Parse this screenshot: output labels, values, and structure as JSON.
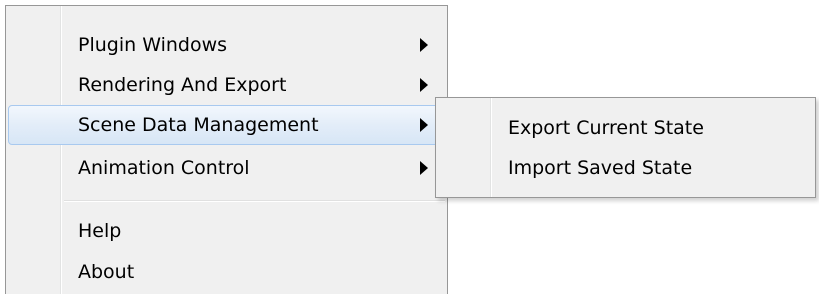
{
  "menu": {
    "items": [
      {
        "label": "Plugin Windows",
        "has_submenu": true
      },
      {
        "label": "Rendering And Export",
        "has_submenu": true
      },
      {
        "label": "Scene Data Management",
        "has_submenu": true,
        "highlighted": true
      },
      {
        "label": "Animation Control",
        "has_submenu": true
      }
    ],
    "secondary_items": [
      {
        "label": "Help"
      },
      {
        "label": "About"
      }
    ]
  },
  "submenu": {
    "items": [
      {
        "label": "Export Current State"
      },
      {
        "label": "Import Saved State"
      }
    ]
  },
  "colors": {
    "menu_background": "#f0f0f0",
    "menu_border": "#979797",
    "highlight_border": "#a8c9ef",
    "highlight_fill": "#dde9f7"
  }
}
